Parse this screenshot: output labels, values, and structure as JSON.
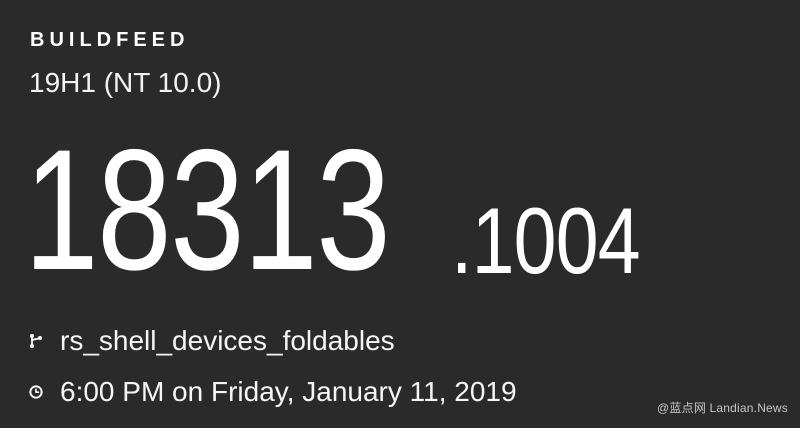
{
  "header": {
    "brand": "BUILDFEED",
    "lab": "19H1 (NT 10.0)"
  },
  "build": {
    "major": "18313",
    "minor": ".1004"
  },
  "details": {
    "branch": "rs_shell_devices_foldables",
    "compiled": "6:00 PM on Friday, January 11, 2019"
  },
  "icons": {
    "branch": "branch-icon",
    "clock": "clock-icon"
  },
  "watermark": "@蓝点网 Landian.News"
}
